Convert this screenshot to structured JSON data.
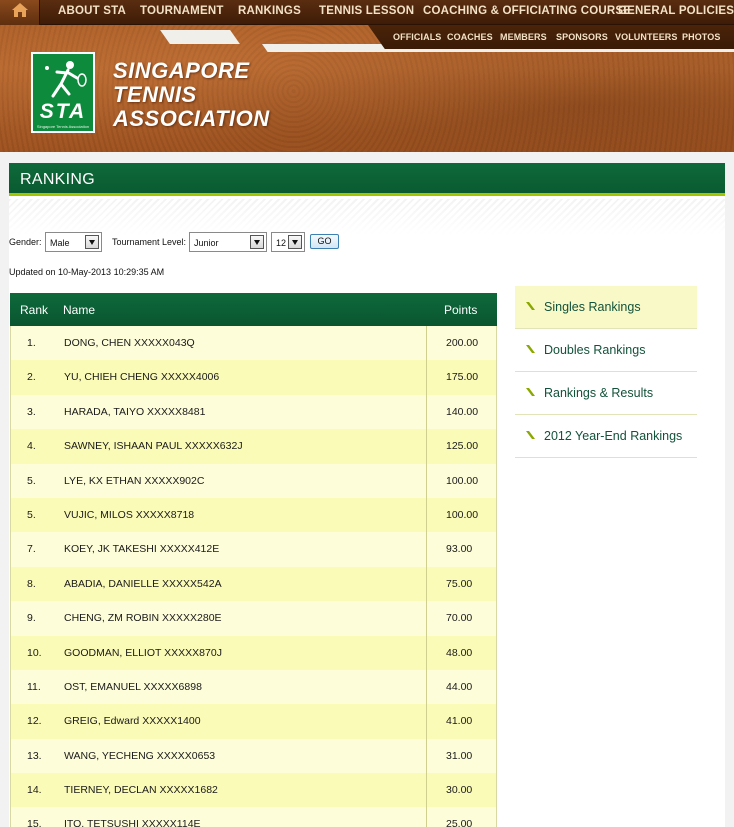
{
  "nav": {
    "home_icon": "home-icon",
    "items": [
      "ABOUT STA",
      "TOURNAMENT",
      "RANKINGS",
      "TENNIS LESSON",
      "COACHING & OFFICIATING COURSE",
      "GENERAL POLICIES"
    ],
    "subitems": [
      "OFFICIALS",
      "COACHES",
      "MEMBERS",
      "SPONSORS",
      "VOLUNTEERS",
      "PHOTOS"
    ]
  },
  "brand": {
    "logo_letters": "STA",
    "logo_small_text": "Singapore Tennis Association",
    "line1": "SINGAPORE",
    "line2": "TENNIS",
    "line3": "ASSOCIATION",
    "colors": {
      "green": "#0e8a3c",
      "header_brown": "#a65a24"
    }
  },
  "page": {
    "title": "RANKING",
    "title_bar_color": "#0e6a3b",
    "accent_line_color": "#a5c400"
  },
  "filters": {
    "gender_label": "Gender:",
    "gender_value": "Male",
    "level_label": "Tournament Level:",
    "level_value": "Junior",
    "age_value": "12",
    "go_label": "GO"
  },
  "updated": "Updated on 10-May-2013 10:29:35 AM",
  "table": {
    "headers": {
      "rank": "Rank",
      "name": "Name",
      "points": "Points"
    },
    "rows": [
      {
        "rank": "1.",
        "name": "DONG, CHEN XXXXX043Q",
        "points": "200.00"
      },
      {
        "rank": "2.",
        "name": "YU, CHIEH CHENG XXXXX4006",
        "points": "175.00"
      },
      {
        "rank": "3.",
        "name": "HARADA, TAIYO XXXXX8481",
        "points": "140.00"
      },
      {
        "rank": "4.",
        "name": "SAWNEY, ISHAAN PAUL XXXXX632J",
        "points": "125.00"
      },
      {
        "rank": "5.",
        "name": "LYE, KX ETHAN XXXXX902C",
        "points": "100.00"
      },
      {
        "rank": "5.",
        "name": "VUJIC, MILOS XXXXX8718",
        "points": "100.00"
      },
      {
        "rank": "7.",
        "name": "KOEY, JK TAKESHI XXXXX412E",
        "points": "93.00"
      },
      {
        "rank": "8.",
        "name": "ABADIA, DANIELLE XXXXX542A",
        "points": "75.00"
      },
      {
        "rank": "9.",
        "name": "CHENG, ZM ROBIN XXXXX280E",
        "points": "70.00"
      },
      {
        "rank": "10.",
        "name": "GOODMAN, ELLIOT XXXXX870J",
        "points": "48.00"
      },
      {
        "rank": "11.",
        "name": "OST, EMANUEL XXXXX6898",
        "points": "44.00"
      },
      {
        "rank": "12.",
        "name": "GREIG, Edward XXXXX1400",
        "points": "41.00"
      },
      {
        "rank": "13.",
        "name": "WANG, YECHENG XXXXX0653",
        "points": "31.00"
      },
      {
        "rank": "14.",
        "name": "TIERNEY, DECLAN XXXXX1682",
        "points": "30.00"
      },
      {
        "rank": "15.",
        "name": "ITO, TETSUSHI XXXXX114E",
        "points": "25.00"
      }
    ]
  },
  "side_menu": {
    "tick_icon": "tick-icon",
    "items": [
      {
        "label": "Singles Rankings",
        "active": true
      },
      {
        "label": "Doubles Rankings",
        "active": false
      },
      {
        "label": "Rankings & Results",
        "active": false
      },
      {
        "label": "2012 Year-End Rankings",
        "active": false
      }
    ]
  }
}
